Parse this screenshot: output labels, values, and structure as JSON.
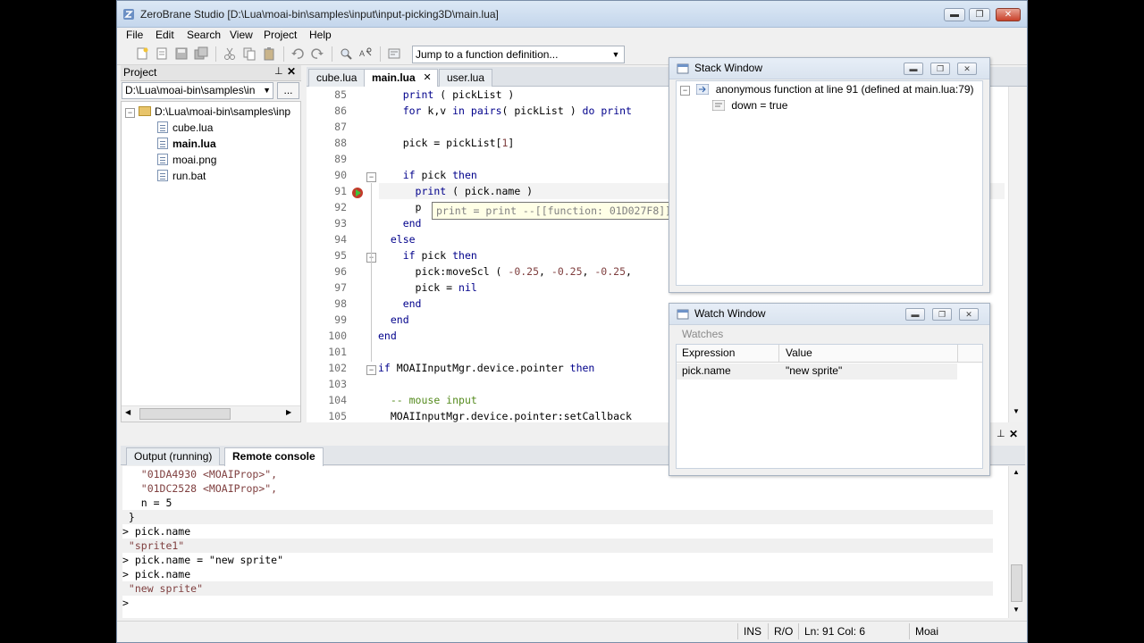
{
  "window": {
    "title": "ZeroBrane Studio [D:\\Lua\\moai-bin\\samples\\input\\input-picking3D\\main.lua]",
    "min_glyph": "▬",
    "max_glyph": "❐",
    "close_glyph": "✕"
  },
  "menu": [
    "File",
    "Edit",
    "Search",
    "View",
    "Project",
    "Help"
  ],
  "toolbar": {
    "jump_combo": "Jump to a function definition..."
  },
  "project": {
    "header": "Project",
    "path": "D:\\Lua\\moai-bin\\samples\\in",
    "browse": "...",
    "root": "D:\\Lua\\moai-bin\\samples\\inp",
    "files": [
      "cube.lua",
      "main.lua",
      "moai.png",
      "run.bat"
    ],
    "collapse_glyph": "−",
    "pin_glyph": "📌",
    "close_glyph": "✕"
  },
  "tabs": [
    "cube.lua",
    "main.lua",
    "user.lua"
  ],
  "tab_close": "✕",
  "editor": {
    "line_numbers": [
      "85",
      "86",
      "87",
      "88",
      "89",
      "90",
      "91",
      "92",
      "93",
      "94",
      "95",
      "96",
      "97",
      "98",
      "99",
      "100",
      "101",
      "102",
      "103",
      "104",
      "105"
    ],
    "tooltip": "print = print --[[function: 01D027F8]]",
    "current_line": "91"
  },
  "stack_window": {
    "title": "Stack Window",
    "frame": "anonymous function at line 91 (defined at main.lua:79)",
    "var": "down = true"
  },
  "watch_window": {
    "title": "Watch Window",
    "section": "Watches",
    "col_expression": "Expression",
    "col_value": "Value",
    "rows": [
      {
        "expression": "pick.name",
        "value": "\"new sprite\""
      }
    ]
  },
  "bottom_tabs": [
    "Output (running)",
    "Remote console"
  ],
  "console": [
    "   \"01DA4930 <MOAIProp>\",",
    "   \"01DC2528 <MOAIProp>\",",
    "   n = 5",
    " }",
    "> pick.name",
    " \"sprite1\"",
    "> pick.name = \"new sprite\"",
    "> pick.name",
    " \"new sprite\"",
    ">"
  ],
  "status": {
    "ins": "INS",
    "ro": "R/O",
    "pos": "Ln: 91 Col: 6",
    "interp": "Moai"
  }
}
